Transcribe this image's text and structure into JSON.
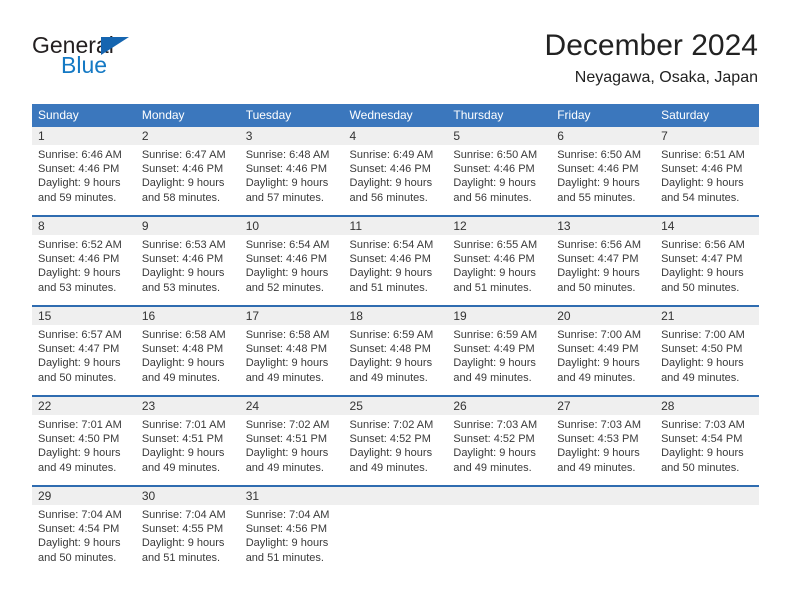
{
  "brand": {
    "name_part1": "General",
    "name_part2": "Blue",
    "triangle_color": "#1565b0",
    "blue_text_color": "#1479c4"
  },
  "header": {
    "title": "December 2024",
    "subtitle": "Neyagawa, Osaka, Japan"
  },
  "theme": {
    "header_row_bg": "#3b77bd",
    "week_divider": "#2f6cb0",
    "daynum_band_bg": "#efefef"
  },
  "weekday_headers": [
    "Sunday",
    "Monday",
    "Tuesday",
    "Wednesday",
    "Thursday",
    "Friday",
    "Saturday"
  ],
  "weeks": [
    [
      {
        "day": "1",
        "sunrise": "Sunrise: 6:46 AM",
        "sunset": "Sunset: 4:46 PM",
        "daylight_line1": "Daylight: 9 hours",
        "daylight_line2": "and 59 minutes."
      },
      {
        "day": "2",
        "sunrise": "Sunrise: 6:47 AM",
        "sunset": "Sunset: 4:46 PM",
        "daylight_line1": "Daylight: 9 hours",
        "daylight_line2": "and 58 minutes."
      },
      {
        "day": "3",
        "sunrise": "Sunrise: 6:48 AM",
        "sunset": "Sunset: 4:46 PM",
        "daylight_line1": "Daylight: 9 hours",
        "daylight_line2": "and 57 minutes."
      },
      {
        "day": "4",
        "sunrise": "Sunrise: 6:49 AM",
        "sunset": "Sunset: 4:46 PM",
        "daylight_line1": "Daylight: 9 hours",
        "daylight_line2": "and 56 minutes."
      },
      {
        "day": "5",
        "sunrise": "Sunrise: 6:50 AM",
        "sunset": "Sunset: 4:46 PM",
        "daylight_line1": "Daylight: 9 hours",
        "daylight_line2": "and 56 minutes."
      },
      {
        "day": "6",
        "sunrise": "Sunrise: 6:50 AM",
        "sunset": "Sunset: 4:46 PM",
        "daylight_line1": "Daylight: 9 hours",
        "daylight_line2": "and 55 minutes."
      },
      {
        "day": "7",
        "sunrise": "Sunrise: 6:51 AM",
        "sunset": "Sunset: 4:46 PM",
        "daylight_line1": "Daylight: 9 hours",
        "daylight_line2": "and 54 minutes."
      }
    ],
    [
      {
        "day": "8",
        "sunrise": "Sunrise: 6:52 AM",
        "sunset": "Sunset: 4:46 PM",
        "daylight_line1": "Daylight: 9 hours",
        "daylight_line2": "and 53 minutes."
      },
      {
        "day": "9",
        "sunrise": "Sunrise: 6:53 AM",
        "sunset": "Sunset: 4:46 PM",
        "daylight_line1": "Daylight: 9 hours",
        "daylight_line2": "and 53 minutes."
      },
      {
        "day": "10",
        "sunrise": "Sunrise: 6:54 AM",
        "sunset": "Sunset: 4:46 PM",
        "daylight_line1": "Daylight: 9 hours",
        "daylight_line2": "and 52 minutes."
      },
      {
        "day": "11",
        "sunrise": "Sunrise: 6:54 AM",
        "sunset": "Sunset: 4:46 PM",
        "daylight_line1": "Daylight: 9 hours",
        "daylight_line2": "and 51 minutes."
      },
      {
        "day": "12",
        "sunrise": "Sunrise: 6:55 AM",
        "sunset": "Sunset: 4:46 PM",
        "daylight_line1": "Daylight: 9 hours",
        "daylight_line2": "and 51 minutes."
      },
      {
        "day": "13",
        "sunrise": "Sunrise: 6:56 AM",
        "sunset": "Sunset: 4:47 PM",
        "daylight_line1": "Daylight: 9 hours",
        "daylight_line2": "and 50 minutes."
      },
      {
        "day": "14",
        "sunrise": "Sunrise: 6:56 AM",
        "sunset": "Sunset: 4:47 PM",
        "daylight_line1": "Daylight: 9 hours",
        "daylight_line2": "and 50 minutes."
      }
    ],
    [
      {
        "day": "15",
        "sunrise": "Sunrise: 6:57 AM",
        "sunset": "Sunset: 4:47 PM",
        "daylight_line1": "Daylight: 9 hours",
        "daylight_line2": "and 50 minutes."
      },
      {
        "day": "16",
        "sunrise": "Sunrise: 6:58 AM",
        "sunset": "Sunset: 4:48 PM",
        "daylight_line1": "Daylight: 9 hours",
        "daylight_line2": "and 49 minutes."
      },
      {
        "day": "17",
        "sunrise": "Sunrise: 6:58 AM",
        "sunset": "Sunset: 4:48 PM",
        "daylight_line1": "Daylight: 9 hours",
        "daylight_line2": "and 49 minutes."
      },
      {
        "day": "18",
        "sunrise": "Sunrise: 6:59 AM",
        "sunset": "Sunset: 4:48 PM",
        "daylight_line1": "Daylight: 9 hours",
        "daylight_line2": "and 49 minutes."
      },
      {
        "day": "19",
        "sunrise": "Sunrise: 6:59 AM",
        "sunset": "Sunset: 4:49 PM",
        "daylight_line1": "Daylight: 9 hours",
        "daylight_line2": "and 49 minutes."
      },
      {
        "day": "20",
        "sunrise": "Sunrise: 7:00 AM",
        "sunset": "Sunset: 4:49 PM",
        "daylight_line1": "Daylight: 9 hours",
        "daylight_line2": "and 49 minutes."
      },
      {
        "day": "21",
        "sunrise": "Sunrise: 7:00 AM",
        "sunset": "Sunset: 4:50 PM",
        "daylight_line1": "Daylight: 9 hours",
        "daylight_line2": "and 49 minutes."
      }
    ],
    [
      {
        "day": "22",
        "sunrise": "Sunrise: 7:01 AM",
        "sunset": "Sunset: 4:50 PM",
        "daylight_line1": "Daylight: 9 hours",
        "daylight_line2": "and 49 minutes."
      },
      {
        "day": "23",
        "sunrise": "Sunrise: 7:01 AM",
        "sunset": "Sunset: 4:51 PM",
        "daylight_line1": "Daylight: 9 hours",
        "daylight_line2": "and 49 minutes."
      },
      {
        "day": "24",
        "sunrise": "Sunrise: 7:02 AM",
        "sunset": "Sunset: 4:51 PM",
        "daylight_line1": "Daylight: 9 hours",
        "daylight_line2": "and 49 minutes."
      },
      {
        "day": "25",
        "sunrise": "Sunrise: 7:02 AM",
        "sunset": "Sunset: 4:52 PM",
        "daylight_line1": "Daylight: 9 hours",
        "daylight_line2": "and 49 minutes."
      },
      {
        "day": "26",
        "sunrise": "Sunrise: 7:03 AM",
        "sunset": "Sunset: 4:52 PM",
        "daylight_line1": "Daylight: 9 hours",
        "daylight_line2": "and 49 minutes."
      },
      {
        "day": "27",
        "sunrise": "Sunrise: 7:03 AM",
        "sunset": "Sunset: 4:53 PM",
        "daylight_line1": "Daylight: 9 hours",
        "daylight_line2": "and 49 minutes."
      },
      {
        "day": "28",
        "sunrise": "Sunrise: 7:03 AM",
        "sunset": "Sunset: 4:54 PM",
        "daylight_line1": "Daylight: 9 hours",
        "daylight_line2": "and 50 minutes."
      }
    ],
    [
      {
        "day": "29",
        "sunrise": "Sunrise: 7:04 AM",
        "sunset": "Sunset: 4:54 PM",
        "daylight_line1": "Daylight: 9 hours",
        "daylight_line2": "and 50 minutes."
      },
      {
        "day": "30",
        "sunrise": "Sunrise: 7:04 AM",
        "sunset": "Sunset: 4:55 PM",
        "daylight_line1": "Daylight: 9 hours",
        "daylight_line2": "and 51 minutes."
      },
      {
        "day": "31",
        "sunrise": "Sunrise: 7:04 AM",
        "sunset": "Sunset: 4:56 PM",
        "daylight_line1": "Daylight: 9 hours",
        "daylight_line2": "and 51 minutes."
      },
      {
        "day": "",
        "sunrise": "",
        "sunset": "",
        "daylight_line1": "",
        "daylight_line2": ""
      },
      {
        "day": "",
        "sunrise": "",
        "sunset": "",
        "daylight_line1": "",
        "daylight_line2": ""
      },
      {
        "day": "",
        "sunrise": "",
        "sunset": "",
        "daylight_line1": "",
        "daylight_line2": ""
      },
      {
        "day": "",
        "sunrise": "",
        "sunset": "",
        "daylight_line1": "",
        "daylight_line2": ""
      }
    ]
  ]
}
